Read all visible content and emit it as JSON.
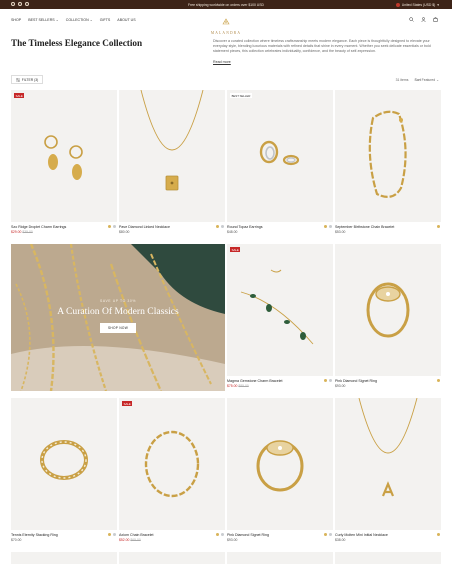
{
  "topbar": {
    "promo": "Free shipping worldwide on orders over $100 USD",
    "region": "United States (USD $)"
  },
  "nav": {
    "items": [
      "Shop",
      "Best Sellers",
      "Collection",
      "Gifts",
      "About Us"
    ]
  },
  "brand": {
    "name": "MALANDRA"
  },
  "collection": {
    "title": "The Timeless Elegance Collection",
    "description": "Discover a curated collection where timeless craftsmanship meets modern elegance. Each piece is thoughtfully designed to elevate your everyday style, blending luxurious materials with refined details that shine in every moment. Whether you seek delicate essentials or bold statement pieces, this collection celebrates individuality, confidence, and the beauty of self-expression.",
    "read_more": "Read more"
  },
  "toolbar": {
    "filter_label": "FILTER (3)",
    "count": "31 items",
    "sort_label": "Sort",
    "sort_value": "Featured"
  },
  "promo_tile": {
    "pretitle": "SAVE UP TO 30%",
    "title": "A Curation Of Modern Classics",
    "button": "SHOP NOW"
  },
  "products": [
    {
      "name": "Szo Ridge Droplet Charm Earrings",
      "price": "$29.00",
      "old_price": "$35.00",
      "badge": "SALE",
      "sale": true
    },
    {
      "name": "Pave Diamond Linked Necklace",
      "price": "$80.00",
      "old_price": "",
      "badge": "",
      "sale": false
    },
    {
      "name": "Round Topaz Earrings",
      "price": "$48.00",
      "old_price": "",
      "badge": "BEST SELLER",
      "sale": false
    },
    {
      "name": "September Birthstone Chain Bracelet",
      "price": "$53.00",
      "old_price": "",
      "badge": "",
      "sale": false
    },
    {
      "name": "Magma Gemstone Charm Bracelet",
      "price": "$75.00",
      "old_price": "$85.00",
      "badge": "SALE",
      "sale": true
    },
    {
      "name": "Pink Diamond Signet Ring",
      "price": "$93.00",
      "old_price": "",
      "badge": "",
      "sale": false
    },
    {
      "name": "Tennis Eternity Stacking Ring",
      "price": "$70.00",
      "old_price": "",
      "badge": "",
      "sale": false
    },
    {
      "name": "Axiom Chain Bracelet",
      "price": "$52.00",
      "old_price": "$65.00",
      "badge": "SALE",
      "sale": true
    },
    {
      "name": "Pink Diamond Signet Ring",
      "price": "$93.00",
      "old_price": "",
      "badge": "",
      "sale": false
    },
    {
      "name": "Curly Molten Mini Initial Necklace",
      "price": "$38.00",
      "old_price": "",
      "badge": "",
      "sale": false
    }
  ],
  "colors": {
    "topbar": "#3d2418",
    "gold": "#c9a045",
    "sale": "#c62828",
    "swatch_gold": "#d9b45a",
    "swatch_silver": "#c9ccd0"
  }
}
